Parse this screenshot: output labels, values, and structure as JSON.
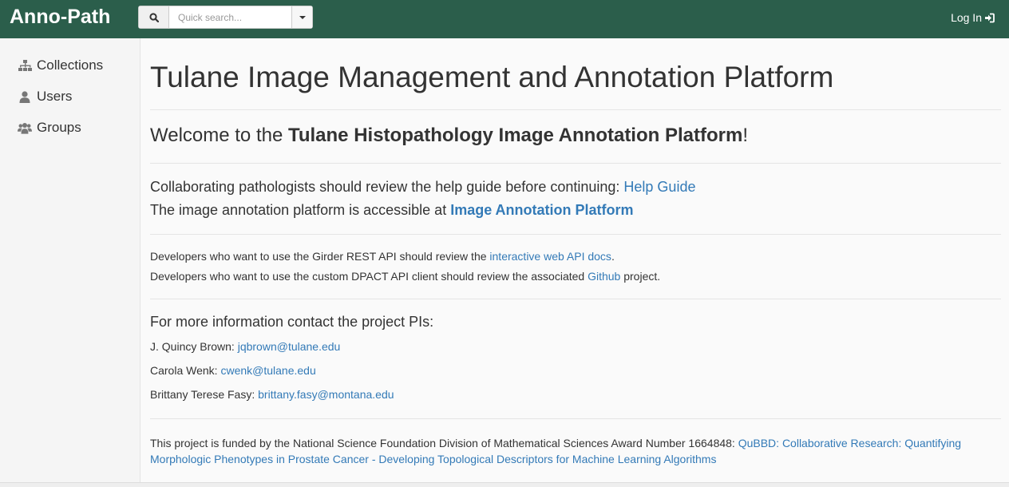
{
  "navbar": {
    "brand": "Anno-Path",
    "search_placeholder": "Quick search...",
    "login_label": "Log In"
  },
  "sidebar": {
    "items": [
      {
        "label": "Collections",
        "icon": "sitemap-icon"
      },
      {
        "label": "Users",
        "icon": "user-icon"
      },
      {
        "label": "Groups",
        "icon": "users-icon"
      }
    ]
  },
  "main": {
    "title": "Tulane Image Management and Annotation Platform",
    "welcome": {
      "prefix": "Welcome to the ",
      "bold": "Tulane Histopathology Image Annotation Platform",
      "suffix": "!"
    },
    "help": {
      "text": "Collaborating pathologists should review the help guide before continuing: ",
      "link": "Help Guide"
    },
    "platform": {
      "text": "The image annotation platform is accessible at ",
      "link": "Image Annotation Platform"
    },
    "dev1": {
      "text": "Developers who want to use the Girder REST API should review the ",
      "link": "interactive web API docs",
      "suffix": "."
    },
    "dev2": {
      "text": "Developers who want to use the custom DPACT API client should review the associated ",
      "link": "Github",
      "suffix": " project."
    },
    "contact_heading": "For more information contact the project PIs:",
    "contacts": [
      {
        "name": "J. Quincy Brown: ",
        "email": "jqbrown@tulane.edu"
      },
      {
        "name": "Carola Wenk: ",
        "email": "cwenk@tulane.edu"
      },
      {
        "name": "Brittany Terese Fasy: ",
        "email": "brittany.fasy@montana.edu"
      }
    ],
    "funding": {
      "text": "This project is funded by the National Science Foundation Division of Mathematical Sciences Award Number 1664848: ",
      "link": "QuBBD: Collaborative Research: Quantifying Morphologic Phenotypes in Prostate Cancer - Developing Topological Descriptors for Machine Learning Algorithms"
    }
  },
  "colors": {
    "navbar": "#2b5e4b",
    "link": "#337ab7",
    "text": "#333333"
  }
}
